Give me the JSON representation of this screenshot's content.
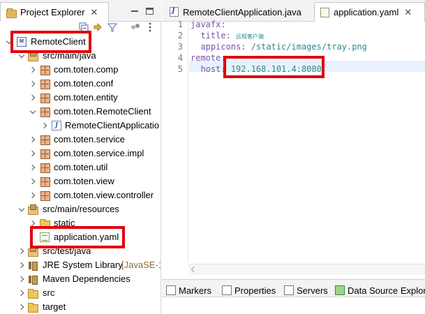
{
  "project_explorer": {
    "tab_label": "Project Explorer",
    "close_glyph": "✕",
    "toolbar_icons": [
      "collapse-all-icon",
      "link-with-editor-icon",
      "filter-icon",
      "view-menu-icon",
      "more-icon"
    ],
    "tree": [
      {
        "label": "RemoteClient",
        "expanded": true,
        "icon": "maven-project-icon"
      },
      {
        "label": "src/main/java",
        "expanded": true,
        "icon": "source-folder-icon"
      },
      {
        "label": "com.toten.comp",
        "icon": "package-icon"
      },
      {
        "label": "com.toten.conf",
        "icon": "package-icon"
      },
      {
        "label": "com.toten.entity",
        "icon": "package-icon"
      },
      {
        "label": "com.toten.RemoteClient",
        "expanded": true,
        "icon": "package-icon"
      },
      {
        "label": "RemoteClientApplicatio",
        "icon": "java-file-icon"
      },
      {
        "label": "com.toten.service",
        "icon": "package-icon"
      },
      {
        "label": "com.toten.service.impl",
        "icon": "package-icon"
      },
      {
        "label": "com.toten.util",
        "icon": "package-icon"
      },
      {
        "label": "com.toten.view",
        "icon": "package-icon"
      },
      {
        "label": "com.toten.view.controller",
        "icon": "package-icon"
      },
      {
        "label": "src/main/resources",
        "expanded": true,
        "icon": "source-folder-icon"
      },
      {
        "label": "static",
        "icon": "folder-icon"
      },
      {
        "label": "application.yaml",
        "icon": "yaml-file-icon"
      },
      {
        "label": "src/test/java",
        "icon": "source-folder-icon"
      },
      {
        "label": "JRE System Library",
        "suffix": "[JavaSE-1",
        "icon": "library-icon"
      },
      {
        "label": "Maven Dependencies",
        "icon": "library-icon"
      },
      {
        "label": "src",
        "icon": "folder-icon"
      },
      {
        "label": "target",
        "icon": "folder-icon"
      }
    ]
  },
  "editor": {
    "tabs": [
      {
        "label": "RemoteClientApplication.java",
        "active": false
      },
      {
        "label": "application.yaml",
        "active": true,
        "close_glyph": "✕"
      }
    ],
    "line_numbers": [
      "1",
      "2",
      "3",
      "4",
      "5"
    ],
    "lines": [
      {
        "key": "javafx:",
        "value": ""
      },
      {
        "key": "  title: ",
        "value": "远程客户端"
      },
      {
        "key": "  appicons: ",
        "value": "/static/images/tray.png"
      },
      {
        "key": "remote:",
        "value": ""
      },
      {
        "key": "  host: ",
        "value": "192.168.101.4:8080"
      }
    ]
  },
  "bottom_views": {
    "tabs": [
      {
        "label": "Markers",
        "icon": "markers-icon"
      },
      {
        "label": "Properties",
        "icon": "properties-icon"
      },
      {
        "label": "Servers",
        "icon": "servers-icon"
      },
      {
        "label": "Data Source Explor",
        "icon": "data-source-icon"
      }
    ]
  },
  "colors": {
    "highlight_box": "#e0000b",
    "yaml_key": "#7a4fae",
    "yaml_value": "#2a8a8a"
  }
}
